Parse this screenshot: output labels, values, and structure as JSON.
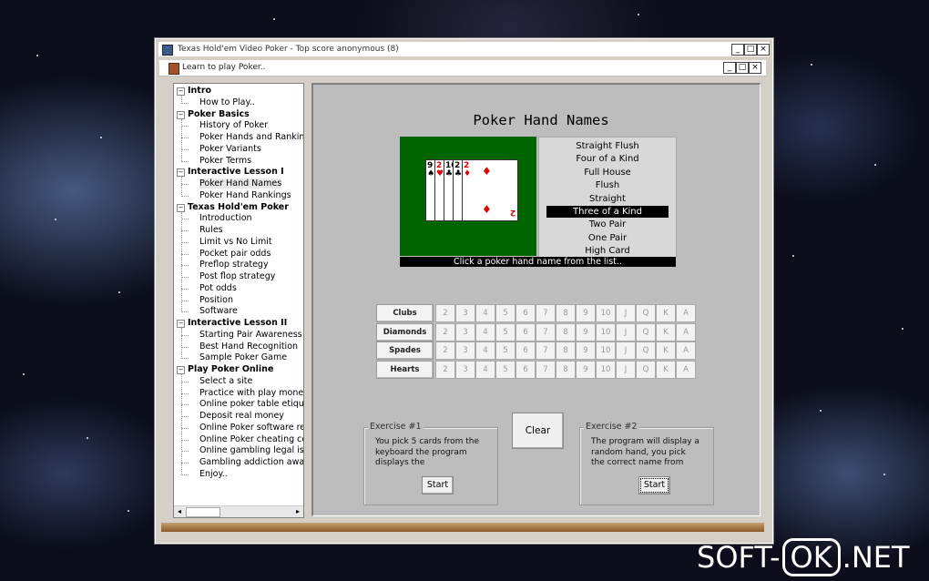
{
  "window": {
    "title": "Texas Hold'em Video Poker -   Top score anonymous (8)",
    "minimize": "_",
    "maximize": "□",
    "close": "×"
  },
  "inner_window": {
    "title": "Learn to play Poker.."
  },
  "tree": {
    "sections": [
      {
        "label": "Intro",
        "items": [
          "How to Play.."
        ]
      },
      {
        "label": "Poker Basics",
        "items": [
          "History of Poker",
          "Poker Hands and Rankings",
          "Poker Variants",
          "Poker Terms"
        ]
      },
      {
        "label": "Interactive Lesson I",
        "items": [
          "Poker Hand Names",
          "Poker Hand Rankings"
        ]
      },
      {
        "label": "Texas Hold'em Poker",
        "items": [
          "Introduction",
          "Rules",
          "Limit vs No Limit",
          "Pocket pair odds",
          "Preflop strategy",
          "Post flop strategy",
          "Pot odds",
          "Position",
          "Software"
        ]
      },
      {
        "label": "Interactive Lesson II",
        "items": [
          "Starting Pair Awareness",
          "Best Hand Recognition",
          "Sample Poker Game"
        ]
      },
      {
        "label": "Play Poker Online",
        "items": [
          "Select a site",
          "Practice with play money",
          "Online poker table etiquette",
          "Deposit real money",
          "Online Poker software review",
          "Online Poker cheating concerns",
          "Online gambling legal issues",
          "Gambling addiction awareness",
          "Enjoy.."
        ]
      }
    ],
    "selected": "Poker Hand Names",
    "expander": "⊟"
  },
  "content": {
    "title": "Poker Hand Names",
    "cards": [
      {
        "rank": "9",
        "suit": "♠",
        "color": "#000000"
      },
      {
        "rank": "2",
        "suit": "♥",
        "color": "#e00000"
      },
      {
        "rank": "10",
        "suit": "♣",
        "color": "#000000"
      },
      {
        "rank": "2",
        "suit": "♣",
        "color": "#000000"
      },
      {
        "rank": "2",
        "suit": "♦",
        "color": "#e00000"
      }
    ],
    "hand_names": [
      "Straight Flush",
      "Four of a Kind",
      "Full House",
      "Flush",
      "Straight",
      "Three of a Kind",
      "Two Pair",
      "One Pair",
      "High Card"
    ],
    "selected_hand": "Three of a Kind",
    "status": "Click a poker hand name from the list..",
    "suits": [
      "Clubs",
      "Diamonds",
      "Spades",
      "Hearts"
    ],
    "ranks": [
      "2",
      "3",
      "4",
      "5",
      "6",
      "7",
      "8",
      "9",
      "10",
      "J",
      "Q",
      "K",
      "A"
    ],
    "clear_label": "Clear",
    "exercise1": {
      "legend": "Exercise #1",
      "text": "You pick 5 cards from the keyboard the program displays the",
      "button": "Start"
    },
    "exercise2": {
      "legend": "Exercise #2",
      "text": "The program will display a random hand, you pick the correct name from",
      "button": "Start"
    }
  },
  "watermark": {
    "left": "SOFT-",
    "box": "OK",
    "right": ".NET"
  }
}
